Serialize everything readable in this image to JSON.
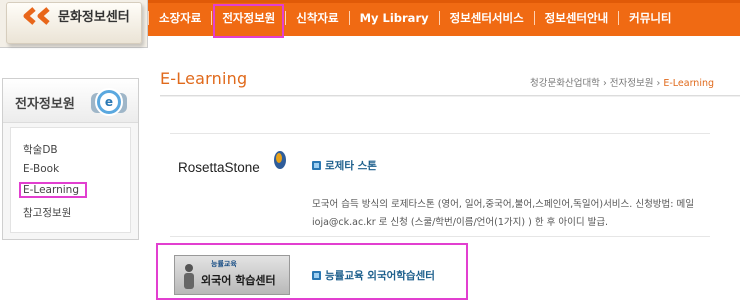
{
  "header": {
    "logo_text": "문화정보센터",
    "nav": [
      {
        "label": "소장자료"
      },
      {
        "label": "전자정보원",
        "highlighted": true
      },
      {
        "label": "신착자료"
      },
      {
        "label": "My Library"
      },
      {
        "label": "정보센터서비스"
      },
      {
        "label": "정보센터안내"
      },
      {
        "label": "커뮤니티"
      }
    ],
    "accent_color": "#f06a13"
  },
  "sidebar": {
    "title": "전자정보원",
    "title_icon": "e-badge-icon",
    "items": [
      {
        "label": "학술DB"
      },
      {
        "label": "E-Book"
      },
      {
        "label": "E-Learning",
        "selected": true
      },
      {
        "label": "참고정보원"
      }
    ]
  },
  "main": {
    "title": "E-Learning",
    "breadcrumb": [
      "청강문화산업대학",
      "전자정보원",
      "E-Learning"
    ],
    "services": [
      {
        "logo_text": "RosettaStone",
        "title": "로제타 스톤",
        "description": "모국어 습득 방식의 로제타스톤 (영어, 일어,중국어,불어,스페인어,독일어)서비스. 신청방법: 메일 ioja@ck.ac.kr 로 신청 (스쿨/학번/이름/언어(1가지) ) 한 후 아이디 발급."
      },
      {
        "logo_sub": "능률교육",
        "logo_text": "외국어 학습센터",
        "title": "능률교육 외국어학습센터",
        "highlighted": true
      }
    ],
    "highlight_color": "#e23fd0"
  }
}
